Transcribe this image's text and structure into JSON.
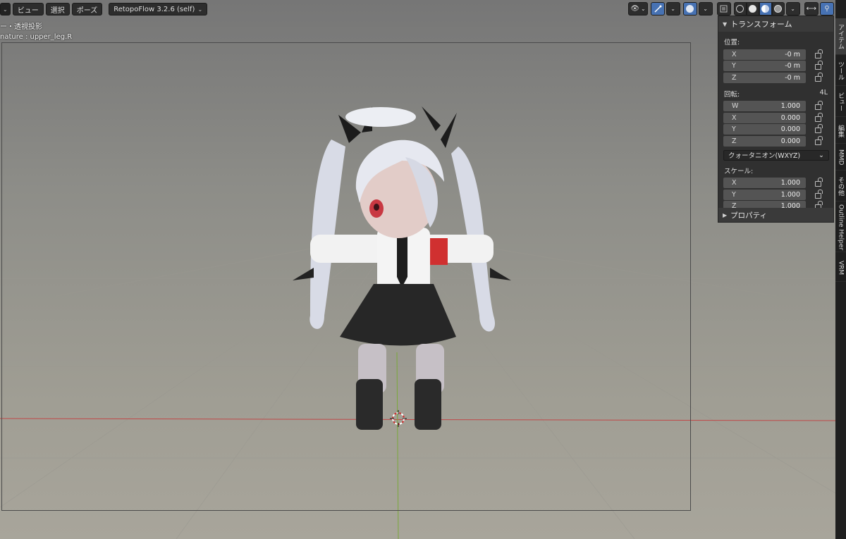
{
  "header": {
    "left_buttons": [
      {
        "label": "ビュー"
      },
      {
        "label": "選択"
      },
      {
        "label": "ポーズ"
      }
    ],
    "addon_dropdown": "RetopoFlow 3.2.6 (self)"
  },
  "viewport_info": {
    "line1": "ー・透視投影",
    "line2": "nature : upper_leg.R"
  },
  "n_panel": {
    "transform_title": "トランスフォーム",
    "location_label": "位置:",
    "location": [
      {
        "axis": "X",
        "value": "-0 m"
      },
      {
        "axis": "Y",
        "value": "-0 m"
      },
      {
        "axis": "Z",
        "value": "-0 m"
      }
    ],
    "rotation_label": "回転:",
    "rotation_mode_short": "4L",
    "rotation": [
      {
        "axis": "W",
        "value": "1.000"
      },
      {
        "axis": "X",
        "value": "0.000"
      },
      {
        "axis": "Y",
        "value": "0.000"
      },
      {
        "axis": "Z",
        "value": "0.000"
      }
    ],
    "rotation_mode": "クォータニオン(WXYZ)",
    "scale_label": "スケール:",
    "scale": [
      {
        "axis": "X",
        "value": "1.000"
      },
      {
        "axis": "Y",
        "value": "1.000"
      },
      {
        "axis": "Z",
        "value": "1.000"
      }
    ],
    "properties_title": "プロパティ"
  },
  "sidebar_tabs": [
    {
      "label": "アイテム",
      "active": true
    },
    {
      "label": "ツール",
      "active": false
    },
    {
      "label": "ビュー",
      "active": false
    },
    {
      "label": "編集",
      "active": false
    },
    {
      "label": "MMD",
      "active": false
    },
    {
      "label": "その他",
      "active": false
    },
    {
      "label": "Outline Helper",
      "active": false
    },
    {
      "label": "VRM",
      "active": false
    }
  ],
  "colors": {
    "accent_blue": "#4772b3",
    "x_axis_line": "#c04848",
    "y_axis_line": "#7aa83a"
  },
  "icons": [
    "visibility-icon",
    "gizmo-icon",
    "overlay-icon",
    "xray-icon",
    "wireframe-shading-icon",
    "solid-shading-icon",
    "material-shading-icon",
    "rendered-shading-icon",
    "arrows-icon",
    "pan-icon",
    "lock-icon",
    "3d-cursor-icon"
  ]
}
